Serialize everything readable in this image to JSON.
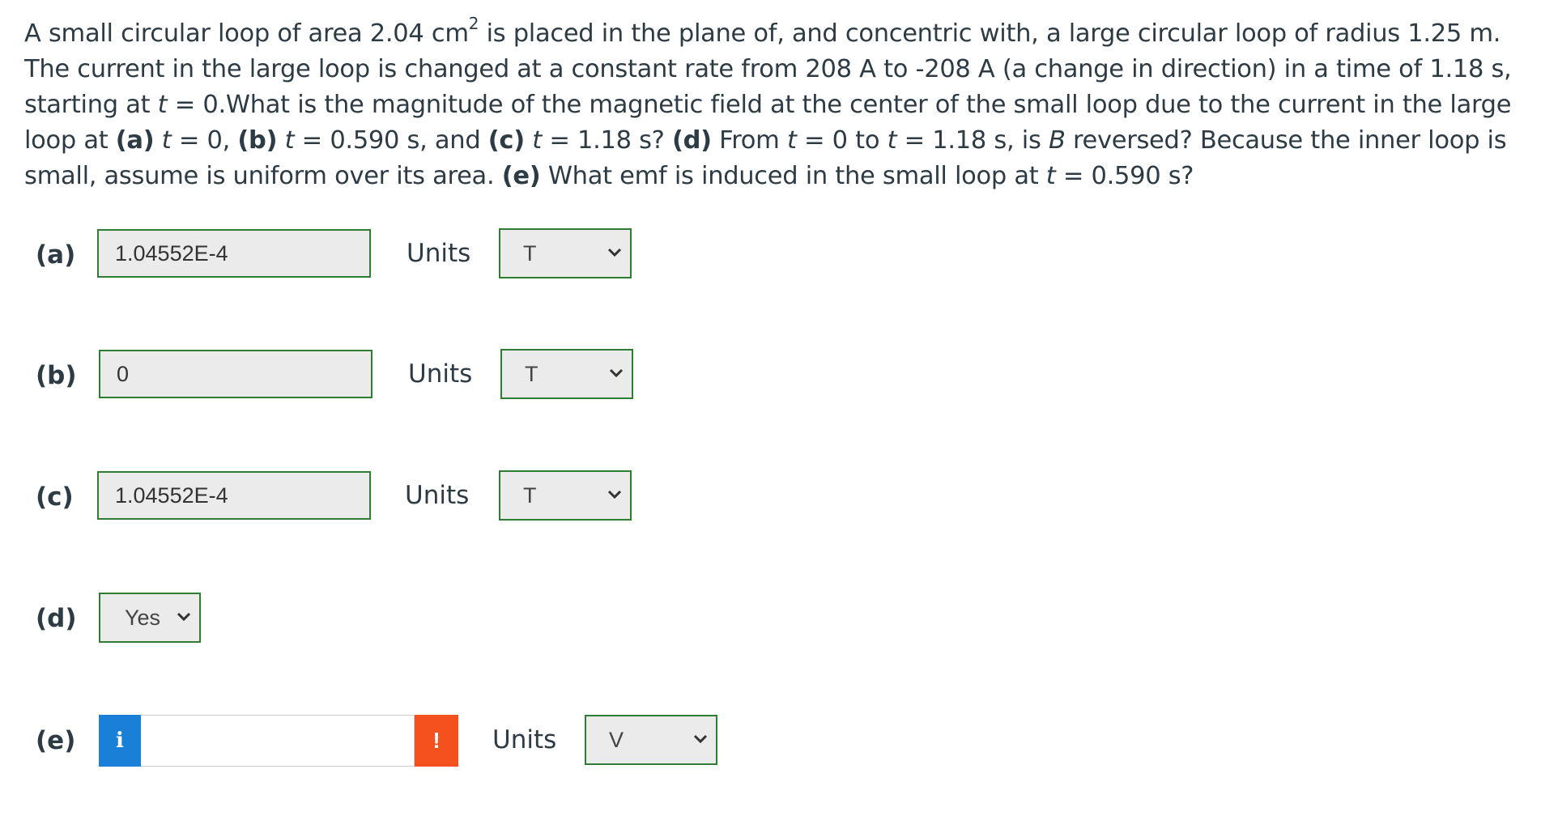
{
  "question": {
    "t1": "A small circular loop of area 2.04 cm",
    "sup": "2",
    "t2": " is placed in the plane of, and concentric with, a large circular loop of radius 1.25 m. The current in the large loop is changed at a constant rate from 208 A to -208 A (a change in direction) in a time of 1.18 s, starting at ",
    "t_var": "t",
    "t3": " = 0.What is the magnitude of the magnetic field at the center of the small loop due to the current in the large loop at ",
    "a_lbl": "(a)",
    "t4": " = 0, ",
    "b_lbl": "(b)",
    "t5": " = 0.590 s, and ",
    "c_lbl": "(c)",
    "t6": " = 1.18 s? ",
    "d_lbl": "(d)",
    "t7": " From ",
    "t8": " = 0 to ",
    "t9": " = 1.18 s, is ",
    "b_var": "B",
    "t10": " reversed? Because the inner loop is small, assume is uniform over its area. ",
    "e_lbl": "(e)",
    "t11": " What emf is induced in the small loop at ",
    "t12": " = 0.590 s?"
  },
  "parts": {
    "a": {
      "label": "(a)",
      "value": "1.04552E-4",
      "units_label": "Units",
      "unit": "T"
    },
    "b": {
      "label": "(b)",
      "value": "0",
      "units_label": "Units",
      "unit": "T"
    },
    "c": {
      "label": "(c)",
      "value": "1.04552E-4",
      "units_label": "Units",
      "unit": "T"
    },
    "d": {
      "label": "(d)",
      "selected": "Yes"
    },
    "e": {
      "label": "(e)",
      "value": "",
      "info_icon": "i",
      "warning_icon": "!",
      "units_label": "Units",
      "unit": "V"
    }
  },
  "colors": {
    "correct_border": "#2f7d32",
    "info_blue": "#1a7fd6",
    "warning_orange": "#f4511e",
    "text": "#2d3b45"
  }
}
